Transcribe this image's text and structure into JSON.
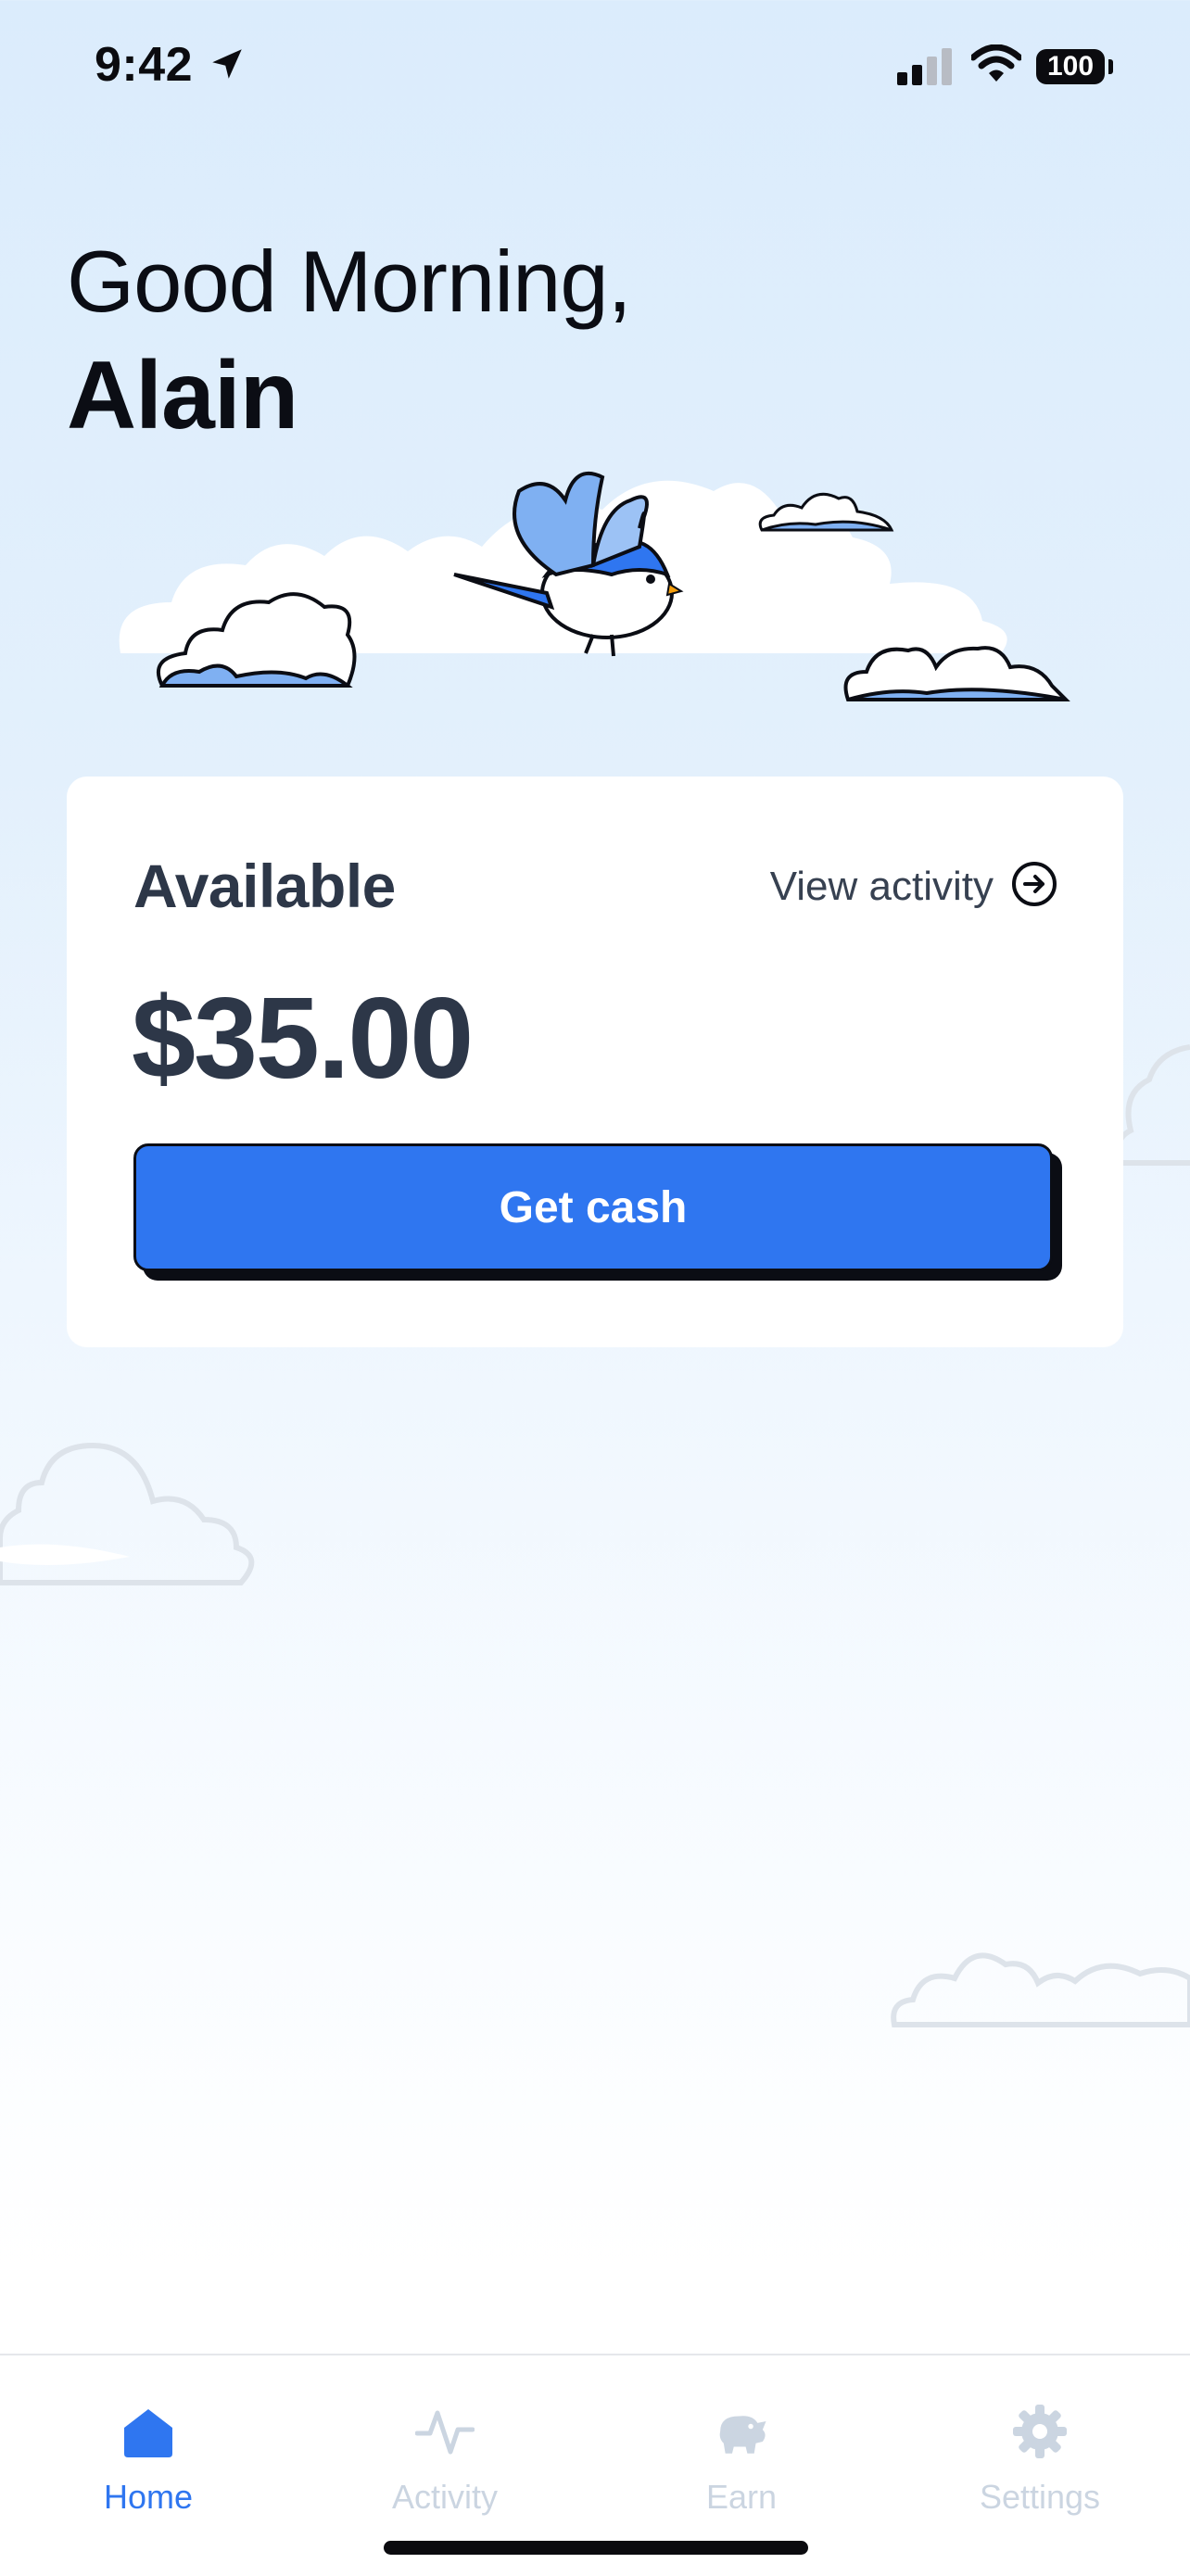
{
  "status_bar": {
    "time": "9:42",
    "battery": "100",
    "icons": [
      "location-arrow-icon",
      "cellular-signal-icon",
      "wifi-icon",
      "battery-icon"
    ]
  },
  "header": {
    "greeting": "Good Morning,",
    "name": "Alain"
  },
  "balance_card": {
    "title": "Available",
    "view_activity_label": "View activity",
    "amount": "$35.00",
    "cta_label": "Get cash"
  },
  "tab_bar": {
    "tabs": [
      {
        "label": "Home",
        "icon": "home-icon",
        "active": true
      },
      {
        "label": "Activity",
        "icon": "activity-icon",
        "active": false
      },
      {
        "label": "Earn",
        "icon": "piggy-bank-icon",
        "active": false
      },
      {
        "label": "Settings",
        "icon": "gear-icon",
        "active": false
      }
    ]
  },
  "colors": {
    "accent": "#2f76f0",
    "text_dark": "#2d3748",
    "tab_inactive": "#cbd5e1",
    "sky_top": "#dbecfc"
  }
}
